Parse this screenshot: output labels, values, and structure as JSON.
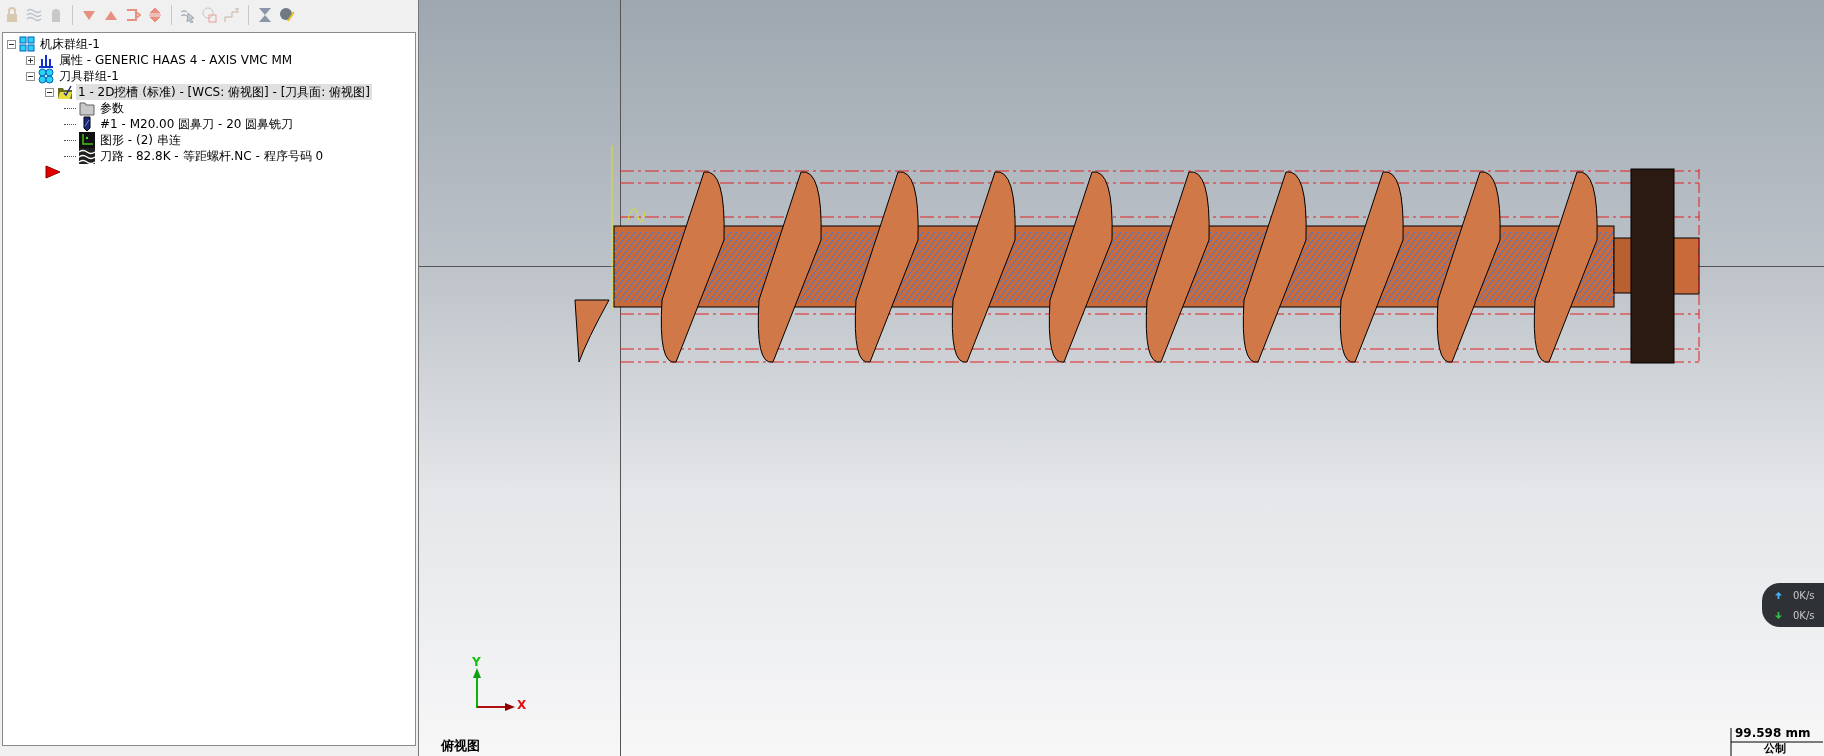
{
  "tree": [
    {
      "label": "机床群组-1",
      "kind": "machine-group",
      "expanded": true,
      "selected": false,
      "children": [
        {
          "label": "属性 - GENERIC HAAS 4 - AXIS VMC MM",
          "kind": "properties",
          "expanded": false,
          "selected": false
        },
        {
          "label": "刀具群组-1",
          "kind": "tool-group",
          "expanded": true,
          "selected": false,
          "children": [
            {
              "label": "1 - 2D挖槽 (标准) - [WCS: 俯视图] - [刀具面: 俯视图]",
              "kind": "operation",
              "expanded": true,
              "selected": true,
              "children": [
                {
                  "label": "参数",
                  "kind": "folder",
                  "selected": false
                },
                {
                  "label": "#1 - M20.00 圆鼻刀 - 20 圆鼻铣刀",
                  "kind": "tool",
                  "selected": false
                },
                {
                  "label": "图形 - (2) 串连",
                  "kind": "geometry",
                  "selected": false
                },
                {
                  "label": "刀路 - 82.8K - 等距螺杆.NC - 程序号码 0",
                  "kind": "toolpath",
                  "selected": false
                }
              ]
            }
          ]
        }
      ]
    }
  ],
  "viewport": {
    "axes": {
      "y": "Y",
      "x": "X"
    },
    "view_label": "俯视图",
    "scale": {
      "value": "99.598 mm",
      "units": "公制"
    }
  },
  "net_monitor": [
    {
      "kind": "up",
      "reading": "0K/s"
    },
    {
      "kind": "down",
      "reading": "0K/s"
    }
  ]
}
